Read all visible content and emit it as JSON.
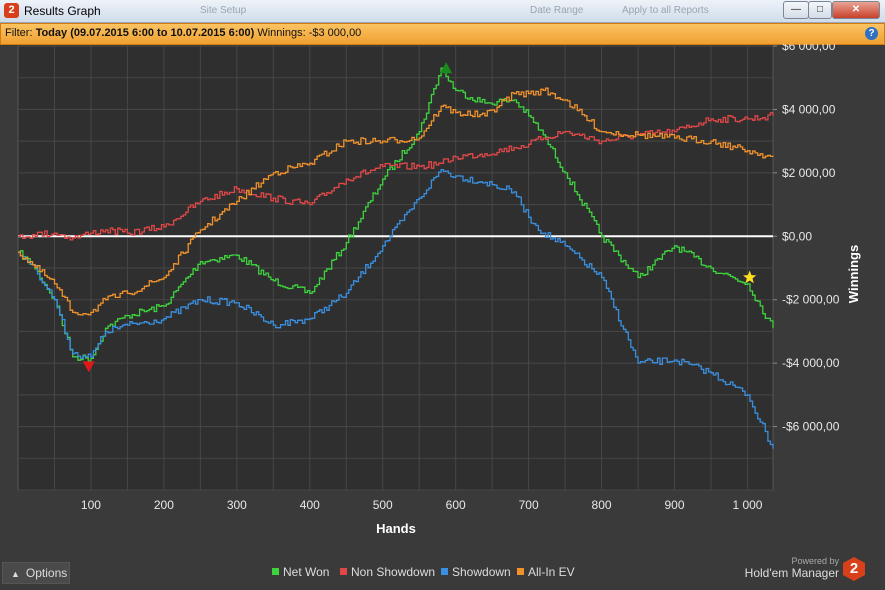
{
  "window": {
    "title": "Results Graph",
    "ghost_items": [
      "Site Setup",
      "Date Range",
      "Apply to all Reports"
    ],
    "buttons": {
      "minimize": "—",
      "maximize": "□",
      "close": "✕"
    }
  },
  "filter": {
    "prefix": "Filter:",
    "range": "Today (09.07.2015 6:00 to 10.07.2015 6:00)",
    "winnings_label": "Winnings:",
    "winnings_value": "-$3 000,00"
  },
  "footer": {
    "options_label": "Options",
    "powered_by": "Powered by",
    "brand": "Hold'em Manager",
    "logo_text": "2"
  },
  "colors": {
    "net_won": "#3ed23e",
    "non_showdown": "#e04848",
    "showdown": "#3a8fe0",
    "all_in_ev": "#f0922c",
    "zero_line": "#ffffff"
  },
  "chart_data": {
    "type": "line",
    "xlabel": "Hands",
    "ylabel": "Winnings",
    "xlim": [
      0,
      1035
    ],
    "ylim": [
      -8000,
      6000
    ],
    "x_ticks": [
      100,
      200,
      300,
      400,
      500,
      600,
      700,
      800,
      900,
      1000
    ],
    "x_tick_labels": [
      "100",
      "200",
      "300",
      "400",
      "500",
      "600",
      "700",
      "800",
      "900",
      "1 000"
    ],
    "y_ticks": [
      -6000,
      -4000,
      -2000,
      0,
      2000,
      4000,
      6000
    ],
    "y_tick_labels": [
      "-$6 000,00",
      "-$4 000,00",
      "-$2 000,00",
      "$0,00",
      "$2 000,00",
      "$4 000,00",
      "$6 000,00"
    ],
    "x": [
      0,
      20,
      50,
      75,
      100,
      120,
      150,
      200,
      250,
      300,
      350,
      400,
      450,
      500,
      550,
      580,
      600,
      640,
      680,
      700,
      720,
      750,
      800,
      850,
      900,
      950,
      1000,
      1035
    ],
    "series": [
      {
        "name": "Net Won",
        "color": "#3ed23e",
        "values": [
          -500,
          -900,
          -2000,
          -3800,
          -3850,
          -2900,
          -2500,
          -2200,
          -800,
          -600,
          -1400,
          -1800,
          -200,
          1800,
          3300,
          5300,
          4600,
          4200,
          4300,
          3800,
          3200,
          2000,
          0,
          -1300,
          -300,
          -1000,
          -1500,
          -2900
        ]
      },
      {
        "name": "Non Showdown",
        "color": "#e04848",
        "values": [
          0,
          50,
          100,
          -50,
          100,
          200,
          100,
          300,
          1100,
          1500,
          1200,
          1000,
          1800,
          2200,
          2200,
          2300,
          2500,
          2600,
          2800,
          2900,
          3100,
          3300,
          3000,
          3200,
          3300,
          3700,
          3700,
          3800
        ]
      },
      {
        "name": "Showdown",
        "color": "#3a8fe0",
        "values": [
          -500,
          -900,
          -2000,
          -3700,
          -3800,
          -3000,
          -2800,
          -2600,
          -2000,
          -2100,
          -2800,
          -2600,
          -1800,
          -300,
          1200,
          2100,
          1900,
          1700,
          1400,
          600,
          100,
          -300,
          -1300,
          -4000,
          -3900,
          -4300,
          -5000,
          -6700
        ]
      },
      {
        "name": "All-In EV",
        "color": "#f0922c",
        "values": [
          -500,
          -900,
          -1500,
          -2400,
          -2400,
          -2000,
          -1800,
          -1300,
          200,
          1100,
          2000,
          2300,
          3000,
          3000,
          3100,
          4100,
          3900,
          3800,
          4500,
          4500,
          4600,
          4300,
          3300,
          3200,
          3100,
          3000,
          2700,
          2500
        ]
      }
    ],
    "markers": [
      {
        "type": "triangle-up",
        "x": 587,
        "y": 5300,
        "color": "#1a8a1a"
      },
      {
        "type": "triangle-down",
        "x": 97,
        "y": -4100,
        "color": "#e01818"
      },
      {
        "type": "star",
        "x": 1003,
        "y": -1300,
        "color": "#ffe020"
      }
    ],
    "grid": true,
    "legend_position": "bottom-center"
  }
}
